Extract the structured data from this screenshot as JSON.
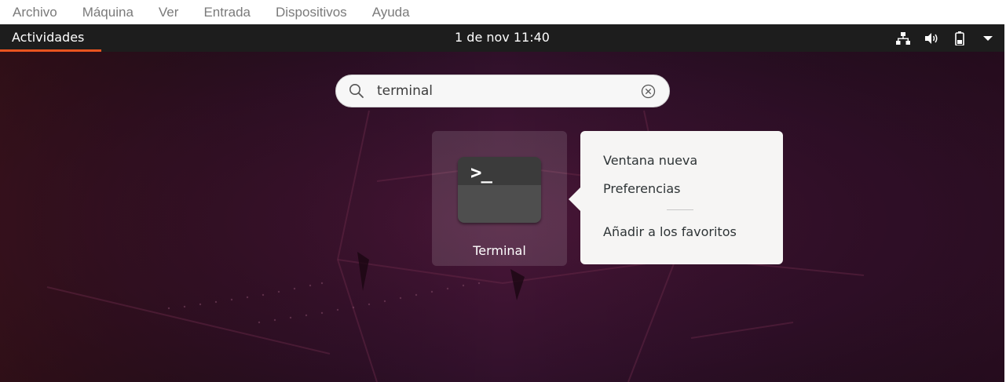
{
  "host_menu": [
    "Archivo",
    "Máquina",
    "Ver",
    "Entrada",
    "Dispositivos",
    "Ayuda"
  ],
  "topbar": {
    "activities_label": "Actividades",
    "clock": "1 de nov  11:40",
    "status_icons": [
      "network-icon",
      "volume-icon",
      "battery-icon",
      "system-menu-arrow-icon"
    ]
  },
  "search": {
    "value": "terminal"
  },
  "app_result": {
    "label": "Terminal",
    "icon_glyph": ">_"
  },
  "context_menu": {
    "new_window": "Ventana nueva",
    "preferences": "Preferencias",
    "add_favorites": "Añadir a los favoritos"
  },
  "colors": {
    "accent": "#e95420",
    "topbar": "#1d1d1d",
    "wallpaper": "#2a0f22"
  }
}
